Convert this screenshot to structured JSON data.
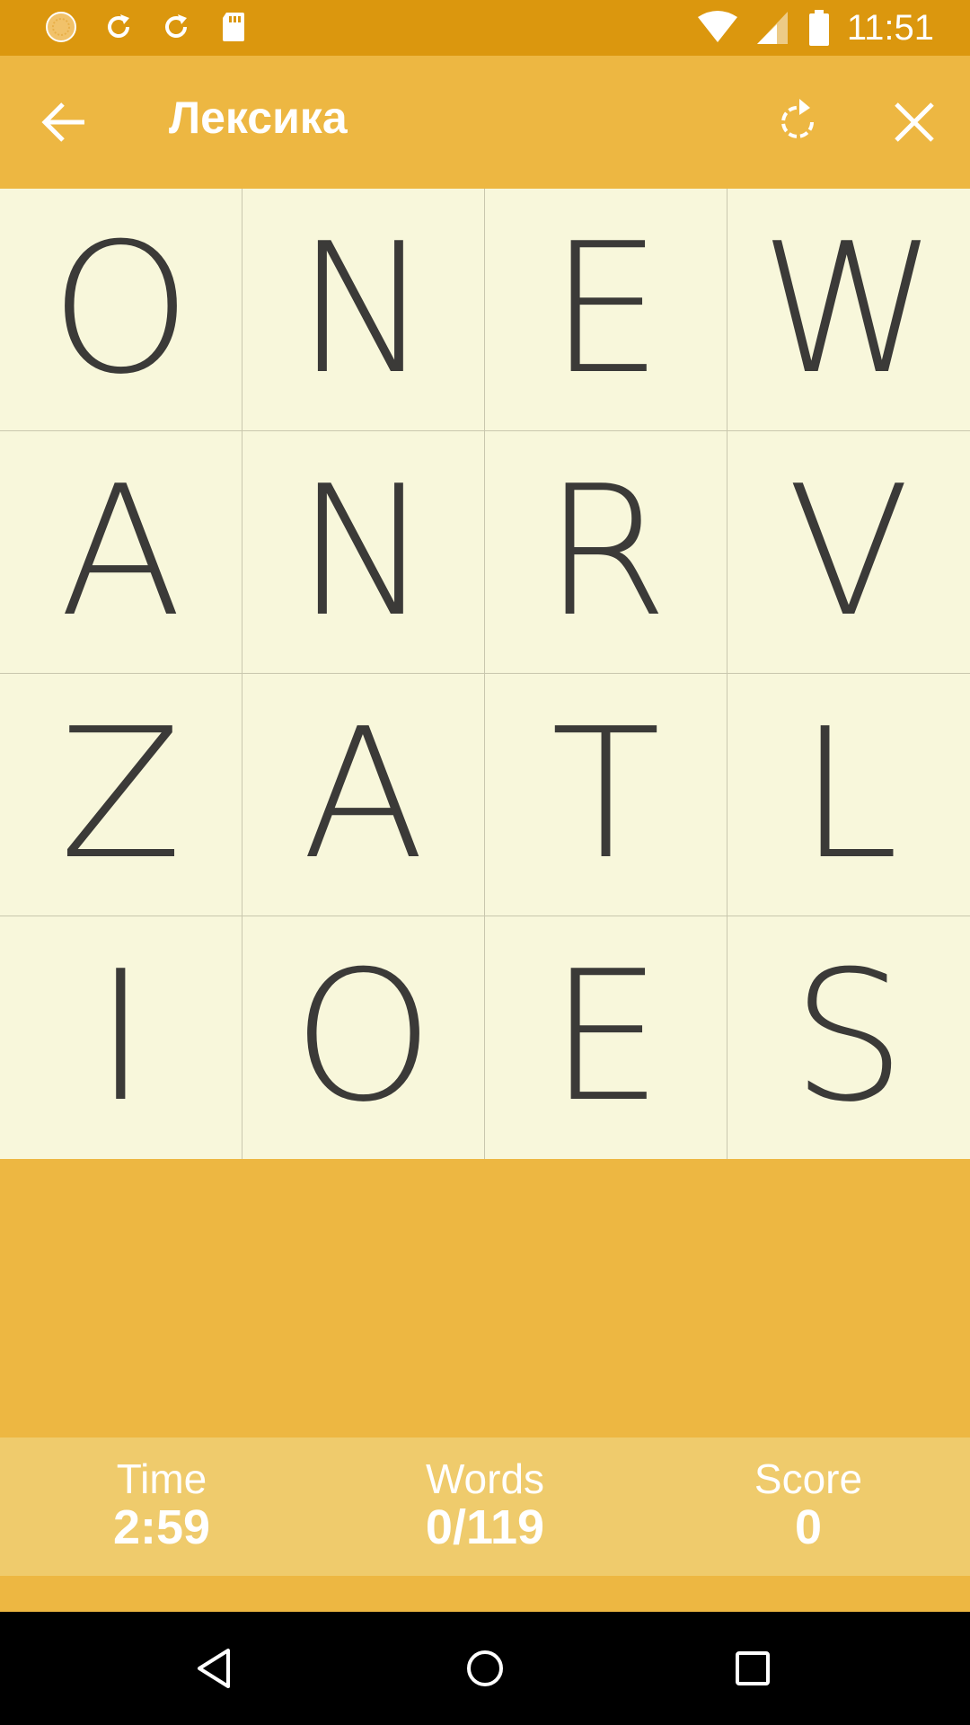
{
  "status_bar": {
    "time": "11:51",
    "icons_left": [
      "sun-icon",
      "sync-icon",
      "sync-icon",
      "sd-card-icon"
    ],
    "icons_right": [
      "wifi-icon",
      "signal-icon",
      "battery-icon"
    ]
  },
  "app_bar": {
    "title": "Лексика",
    "back_icon": "arrow-left-icon",
    "restart_icon": "restart-icon",
    "close_icon": "close-icon"
  },
  "board": {
    "rows": [
      [
        "O",
        "N",
        "E",
        "W"
      ],
      [
        "A",
        "N",
        "R",
        "V"
      ],
      [
        "Z",
        "A",
        "T",
        "L"
      ],
      [
        "I",
        "O",
        "E",
        "S"
      ]
    ]
  },
  "stats": {
    "time_label": "Time",
    "time_value": "2:59",
    "words_label": "Words",
    "words_value": "0/119",
    "score_label": "Score",
    "score_value": "0"
  },
  "nav": {
    "icons": [
      "back-triangle-icon",
      "home-circle-icon",
      "recents-square-icon"
    ]
  },
  "colors": {
    "status_bar": "#DB970E",
    "accent": "#EDB742",
    "board": "#F8F7DB",
    "stats_bar": "#EFCB6C",
    "letter": "#3B3A38"
  }
}
